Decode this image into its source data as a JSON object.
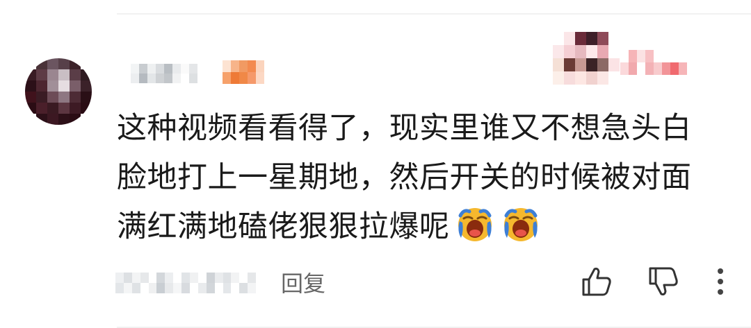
{
  "comment": {
    "lines": [
      "这种视频看看得了，现实里谁又不想急头白",
      "脸地打上一星期地，然后开关的时候被对面",
      "满红满地磕佬狠狠拉爆呢"
    ],
    "emojis": [
      "crying-face",
      "crying-face"
    ]
  },
  "actions": {
    "reply_label": "回复"
  },
  "colors": {
    "text": "#1a1a1a",
    "secondary_text": "#666666",
    "divider": "#f1f1f1"
  }
}
